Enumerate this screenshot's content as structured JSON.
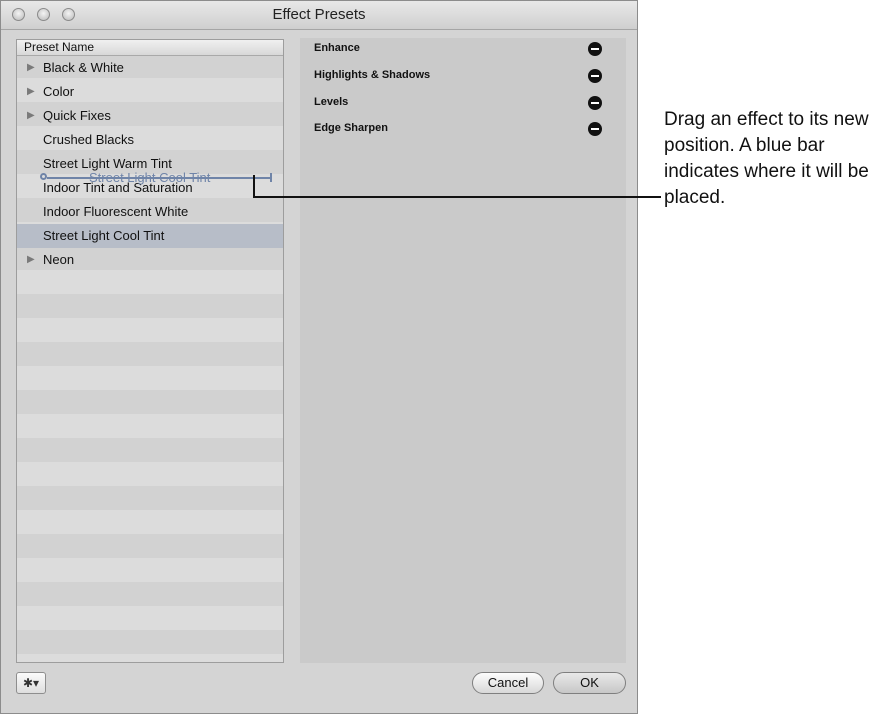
{
  "window": {
    "title": "Effect Presets"
  },
  "presets": {
    "header": "Preset Name",
    "items": [
      {
        "label": "Black & White",
        "expandable": true,
        "selected": false
      },
      {
        "label": "Color",
        "expandable": true,
        "selected": false
      },
      {
        "label": "Quick Fixes",
        "expandable": true,
        "selected": false
      },
      {
        "label": "Crushed Blacks",
        "expandable": false,
        "selected": false
      },
      {
        "label": "Street Light Warm Tint",
        "expandable": false,
        "selected": false
      },
      {
        "label": "Indoor Tint and Saturation",
        "expandable": false,
        "selected": false
      },
      {
        "label": "Indoor Fluorescent White",
        "expandable": false,
        "selected": false
      },
      {
        "label": "Street Light Cool Tint",
        "expandable": false,
        "selected": true
      },
      {
        "label": "Neon",
        "expandable": true,
        "selected": false
      }
    ],
    "drag_ghost": "Street Light Cool Tint"
  },
  "effects": {
    "items": [
      {
        "label": "Enhance"
      },
      {
        "label": "Highlights & Shadows"
      },
      {
        "label": "Levels"
      },
      {
        "label": "Edge Sharpen"
      }
    ]
  },
  "buttons": {
    "gear_icon": "gear-icon",
    "cancel": "Cancel",
    "ok": "OK"
  },
  "callout": {
    "text": "Drag an effect to its new position. A blue bar indicates where it will be placed."
  }
}
